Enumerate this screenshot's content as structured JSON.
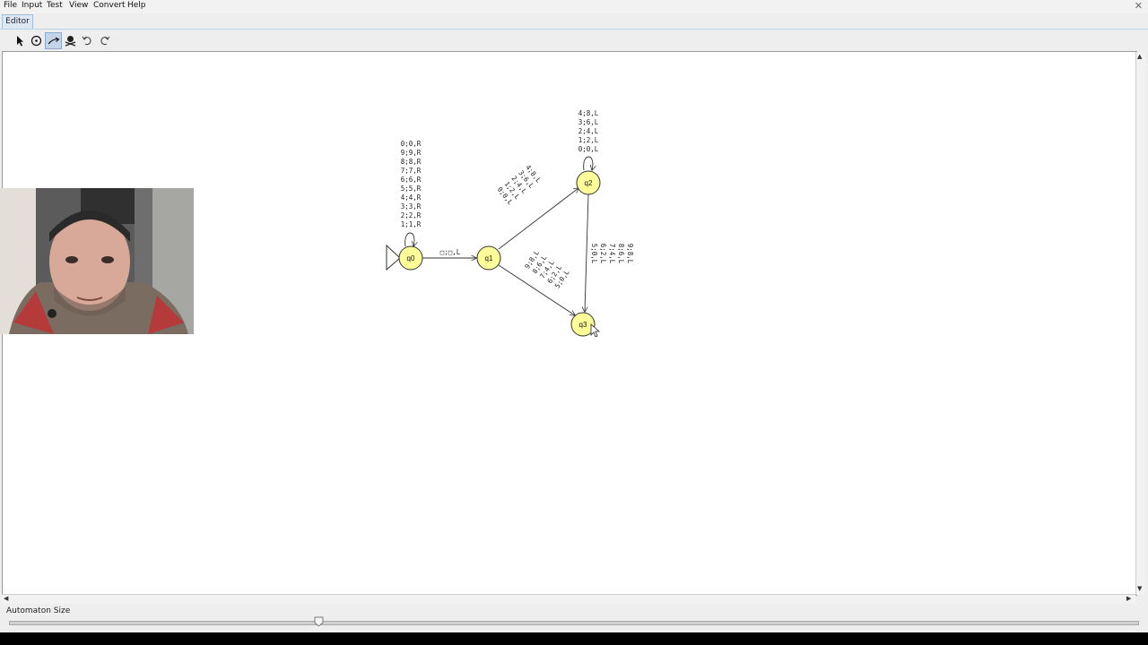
{
  "menu": [
    "File",
    "Input",
    "Test",
    "View",
    "Convert",
    "Help"
  ],
  "tab": "Editor",
  "tools": [
    "pointer-icon",
    "state-icon",
    "transition-icon",
    "delete-icon",
    "undo-icon",
    "redo-icon"
  ],
  "states": [
    "q0",
    "q1",
    "q2",
    "q3"
  ],
  "transitions": {
    "q0_loop": [
      "0;0,R",
      "9;9,R",
      "8;8,R",
      "7;7,R",
      "6;6,R",
      "5;5,R",
      "4;4,R",
      "3;3,R",
      "2;2,R",
      "1;1,R"
    ],
    "q0_q1": "□;□,L",
    "q1_q2": [
      "4;8,L",
      "3;6,L",
      "2;4,L",
      "1;2,L",
      "0;0,L"
    ],
    "q2_loop": [
      "4;8,L",
      "3;6,L",
      "2;4,L",
      "1;2,L",
      "0;0,L"
    ],
    "q1_q3": [
      "9;8,L",
      "8;6,L",
      "7;4,L",
      "6;2,L",
      "5;0,L"
    ],
    "q2_q3": [
      "5;0,L",
      "6;2,L",
      "7;4,L",
      "8;6,L",
      "9;8,L"
    ]
  },
  "status": {
    "size_label": "Automaton Size",
    "size_value": 0.275
  },
  "colors": {
    "state_fill": "#ffff99",
    "state_stroke": "#333333",
    "active_tool": "#c4d5e8"
  }
}
